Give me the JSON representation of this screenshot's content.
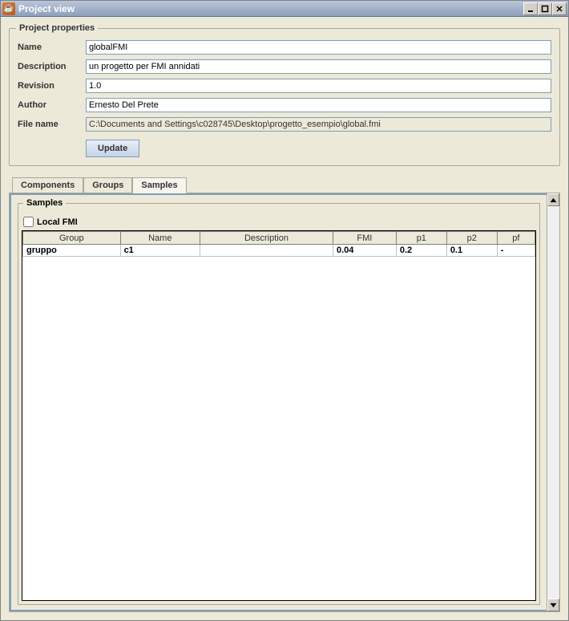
{
  "window": {
    "title": "Project view"
  },
  "project_properties": {
    "legend": "Project properties",
    "fields": {
      "name_label": "Name",
      "name_value": "globalFMI",
      "description_label": "Description",
      "description_value": "un progetto per FMI annidati",
      "revision_label": "Revision",
      "revision_value": "1.0",
      "author_label": "Author",
      "author_value": "Ernesto Del Prete",
      "filename_label": "File name",
      "filename_value": "C:\\Documents and Settings\\c028745\\Desktop\\progetto_esempio\\global.fmi"
    },
    "update_label": "Update"
  },
  "tabs": {
    "components": "Components",
    "groups": "Groups",
    "samples": "Samples"
  },
  "samples_panel": {
    "legend": "Samples",
    "local_fmi_label": "Local FMI",
    "columns": {
      "group": "Group",
      "name": "Name",
      "description": "Description",
      "fmi": "FMI",
      "p1": "p1",
      "p2": "p2",
      "pf": "pf"
    },
    "row": {
      "group": "gruppo",
      "name": "c1",
      "description": "",
      "fmi": "0.04",
      "p1": "0.2",
      "p2": "0.1",
      "pf": "-"
    }
  }
}
